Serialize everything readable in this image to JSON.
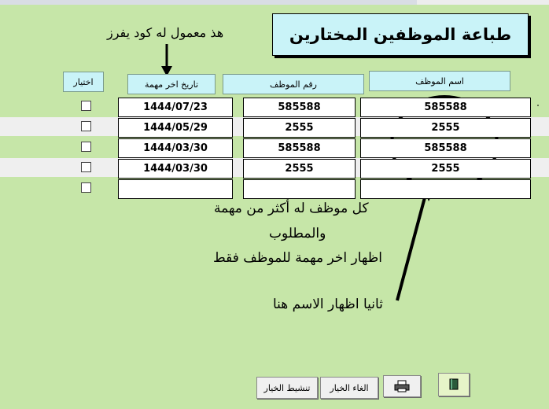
{
  "title": "طباعة الموظفين المختارين",
  "annotations": {
    "top_note": "هذ معمول له كود يفرز",
    "note1": "كل موظف له أكثر من مهمة",
    "note2": "والمطلوب",
    "note3": "اظهار اخر مهمة للموظف فقط",
    "note4": "ثانيا اظهار الاسم هنا"
  },
  "headers": {
    "name": "اسم الموظف",
    "number": "رقم الموظف",
    "date": "تاريخ اخر مهمة",
    "select": "اختيار"
  },
  "rows": [
    {
      "name": "585588",
      "number": "585588",
      "date": "1444/07/23"
    },
    {
      "name": "2555",
      "number": "2555",
      "date": "1444/05/29"
    },
    {
      "name": "585588",
      "number": "585588",
      "date": "1444/03/30"
    },
    {
      "name": "2555",
      "number": "2555",
      "date": "1444/03/30"
    },
    {
      "name": "",
      "number": "",
      "date": ""
    }
  ],
  "buttons": {
    "activate": "تنشيط الخيار",
    "cancel": "الغاء الخيار",
    "print_icon": "printer-icon",
    "book_icon": "book-icon"
  }
}
